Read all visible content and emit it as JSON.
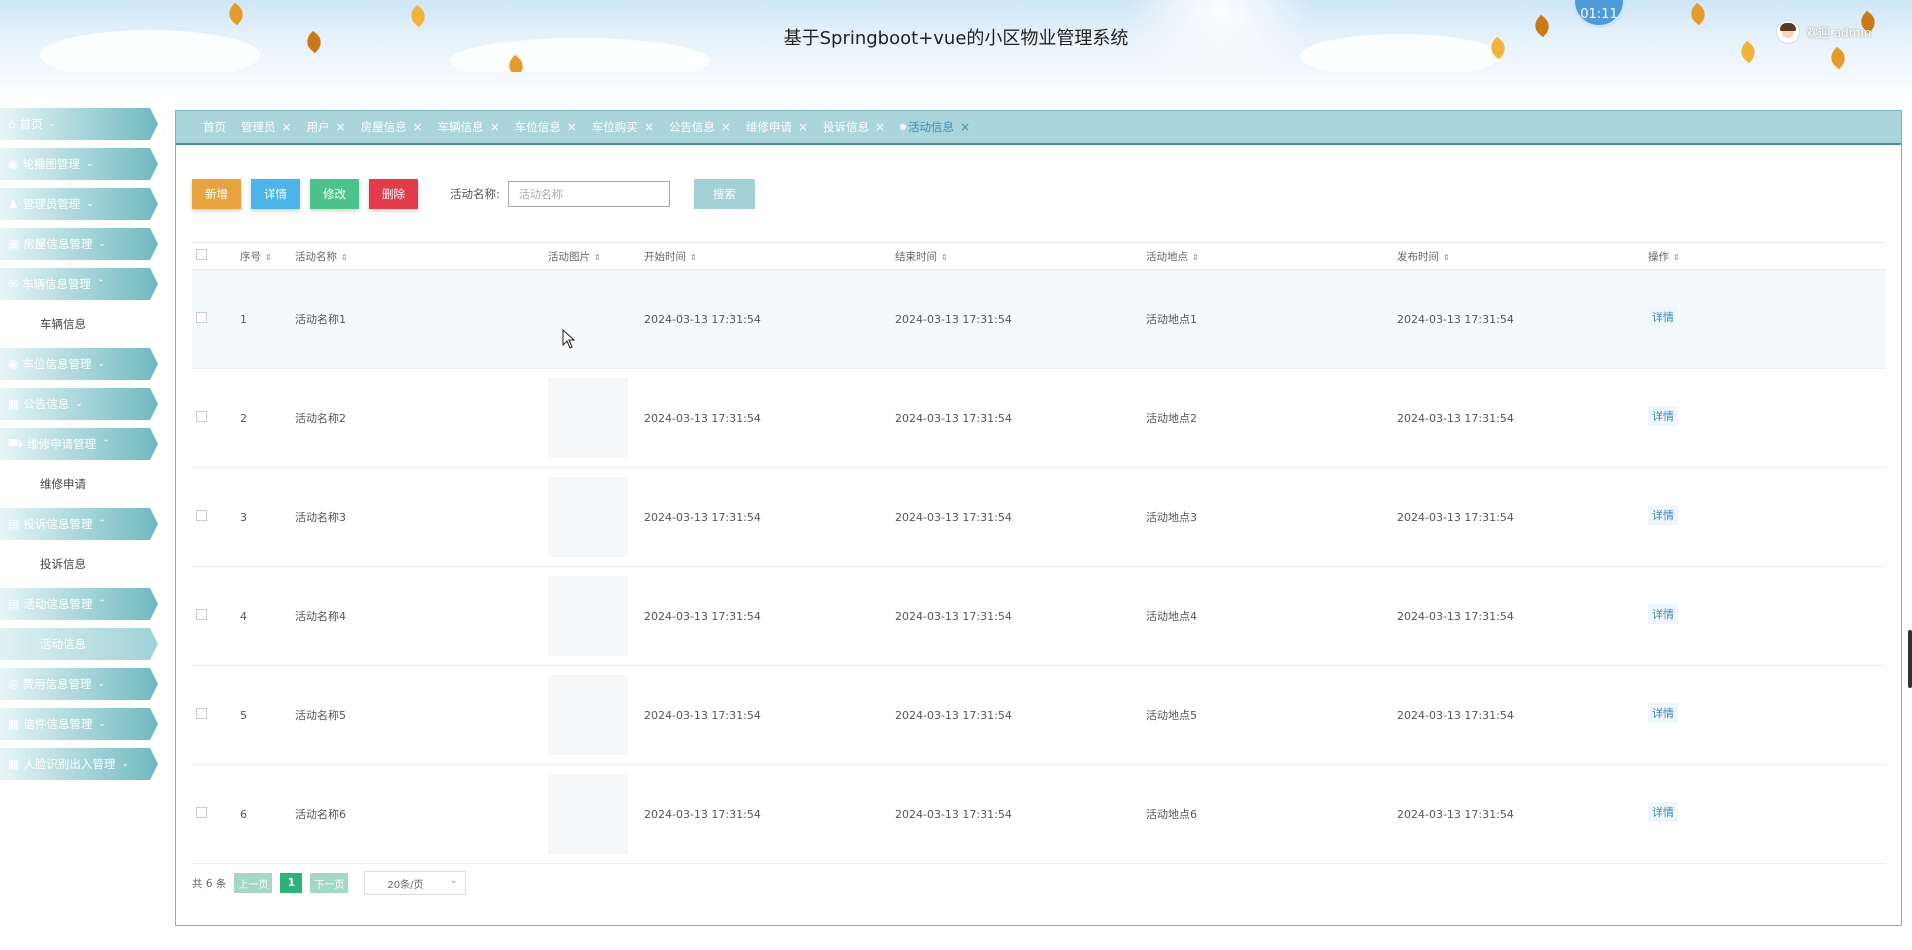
{
  "header": {
    "title": "基于Springboot+vue的小区物业管理系统",
    "clock": "01:11",
    "welcome": "欢迎 admin"
  },
  "sidebar": {
    "items": [
      {
        "icon": "home-icon",
        "glyph": "⌂",
        "label": "首页",
        "chevron": "⌄"
      },
      {
        "icon": "carousel-icon",
        "glyph": "◉",
        "label": "轮播图管理",
        "chevron": "⌄"
      },
      {
        "icon": "admin-icon",
        "glyph": "♟",
        "label": "管理员管理",
        "chevron": "⌄"
      },
      {
        "icon": "house-icon",
        "glyph": "▣",
        "label": "房屋信息管理",
        "chevron": "⌄"
      },
      {
        "icon": "vehicle-icon",
        "glyph": "✉",
        "label": "车辆信息管理",
        "chevron": "⌃",
        "sub": "车辆信息"
      },
      {
        "icon": "parking-icon",
        "glyph": "◉",
        "label": "车位信息管理",
        "chevron": "⌄"
      },
      {
        "icon": "notice-icon",
        "glyph": "▦",
        "label": "公告信息",
        "chevron": "⌄"
      },
      {
        "icon": "repair-icon",
        "glyph": "⛟",
        "label": "维修申请管理",
        "chevron": "⌃",
        "sub": "维修申请"
      },
      {
        "icon": "complaint-icon",
        "glyph": "▤",
        "label": "投诉信息管理",
        "chevron": "⌃",
        "sub": "投诉信息"
      },
      {
        "icon": "activity-icon",
        "glyph": "▤",
        "label": "活动信息管理",
        "chevron": "⌃",
        "sub": "活动信息"
      },
      {
        "icon": "fee-icon",
        "glyph": "◎",
        "label": "费用信息管理",
        "chevron": "⌄"
      },
      {
        "icon": "mail-icon",
        "glyph": "▦",
        "label": "信件信息管理",
        "chevron": "⌄"
      },
      {
        "icon": "face-icon",
        "glyph": "▦",
        "label": "人脸识别出入管理",
        "chevron": "⌄"
      }
    ]
  },
  "tabs": [
    {
      "label": "首页",
      "close": ""
    },
    {
      "label": "管理员",
      "close": "×"
    },
    {
      "label": "用户",
      "close": "×"
    },
    {
      "label": "房屋信息",
      "close": "×"
    },
    {
      "label": "车辆信息",
      "close": "×"
    },
    {
      "label": "车位信息",
      "close": "×"
    },
    {
      "label": "车位购买",
      "close": "×"
    },
    {
      "label": "公告信息",
      "close": "×"
    },
    {
      "label": "维修申请",
      "close": "×"
    },
    {
      "label": "投诉信息",
      "close": "×"
    },
    {
      "label": "活动信息",
      "close": "×"
    }
  ],
  "toolbar": {
    "add": "新增",
    "detail": "详情",
    "edit": "修改",
    "delete": "删除",
    "search_label": "活动名称:",
    "search_placeholder": "活动名称",
    "search_button": "搜索"
  },
  "table": {
    "sort_glyph": "⇕",
    "columns": [
      "序号",
      "活动名称",
      "活动图片",
      "开始时间",
      "结束时间",
      "活动地点",
      "发布时间",
      "操作"
    ],
    "rows": [
      {
        "idx": "1",
        "name": "活动名称1",
        "start": "2024-03-13 17:31:54",
        "end": "2024-03-13 17:31:54",
        "location": "活动地点1",
        "published": "2024-03-13 17:31:54",
        "op": "详情"
      },
      {
        "idx": "2",
        "name": "活动名称2",
        "start": "2024-03-13 17:31:54",
        "end": "2024-03-13 17:31:54",
        "location": "活动地点2",
        "published": "2024-03-13 17:31:54",
        "op": "详情"
      },
      {
        "idx": "3",
        "name": "活动名称3",
        "start": "2024-03-13 17:31:54",
        "end": "2024-03-13 17:31:54",
        "location": "活动地点3",
        "published": "2024-03-13 17:31:54",
        "op": "详情"
      },
      {
        "idx": "4",
        "name": "活动名称4",
        "start": "2024-03-13 17:31:54",
        "end": "2024-03-13 17:31:54",
        "location": "活动地点4",
        "published": "2024-03-13 17:31:54",
        "op": "详情"
      },
      {
        "idx": "5",
        "name": "活动名称5",
        "start": "2024-03-13 17:31:54",
        "end": "2024-03-13 17:31:54",
        "location": "活动地点5",
        "published": "2024-03-13 17:31:54",
        "op": "详情"
      },
      {
        "idx": "6",
        "name": "活动名称6",
        "start": "2024-03-13 17:31:54",
        "end": "2024-03-13 17:31:54",
        "location": "活动地点6",
        "published": "2024-03-13 17:31:54",
        "op": "详情"
      }
    ]
  },
  "pager": {
    "total": "共 6 条",
    "prev": "上一页",
    "page": "1",
    "next": "下一页",
    "size": "20条/页",
    "size_chevron": "⌄"
  },
  "colors": {
    "menu": "#9ed1d6",
    "tabbar": "#a9d5db",
    "add": "#e7a33e",
    "detail": "#4cb4e8",
    "edit": "#4cc38a",
    "delete": "#e23b4a",
    "search": "#a3d1d6",
    "page_active": "#2fb27a"
  }
}
